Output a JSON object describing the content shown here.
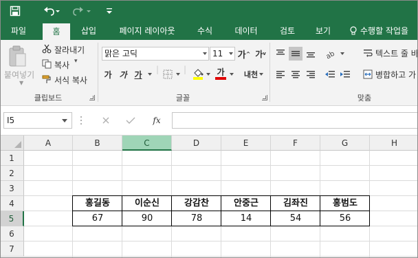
{
  "ribbon_tabs": [
    "파일",
    "홈",
    "삽입",
    "페이지 레이아웃",
    "수식",
    "데이터",
    "검토",
    "보기"
  ],
  "active_tab": "홈",
  "tell_me": "수행할 작업을",
  "clipboard": {
    "paste": "붙여넣기",
    "cut": "잘라내기",
    "copy": "복사",
    "format_painter": "서식 복사",
    "group_label": "클립보드"
  },
  "font": {
    "name": "맑은 고딕",
    "size": "11",
    "bold": "가",
    "italic": "가",
    "underline": "가",
    "font_color_glyph": "가",
    "phonetic": "내천",
    "group_label": "글꼴",
    "grow_glyph": "가",
    "shrink_glyph": "가"
  },
  "alignment": {
    "wrap_text": "텍스트 줄 바",
    "merge_center": "병합하고 가",
    "group_label": "맞춤"
  },
  "formula_bar": {
    "name_box": "I5",
    "fx": "fx",
    "value": ""
  },
  "sheet": {
    "columns": [
      "A",
      "B",
      "C",
      "D",
      "E",
      "F",
      "G",
      "H"
    ],
    "selected_column": "C",
    "rows": [
      "1",
      "2",
      "3",
      "4",
      "5",
      "6",
      "7"
    ],
    "selected_row": "5",
    "names": [
      "홍길동",
      "이순신",
      "강감찬",
      "안중근",
      "김좌진",
      "홍범도"
    ],
    "scores": [
      "67",
      "90",
      "78",
      "14",
      "54",
      "56"
    ]
  },
  "colors": {
    "excel_green": "#217346",
    "selected_col_header": "#9fd5b7"
  }
}
